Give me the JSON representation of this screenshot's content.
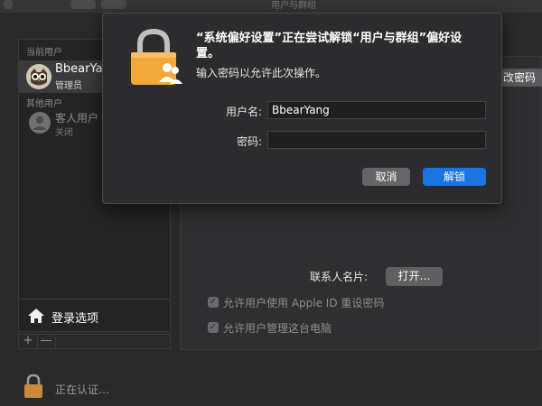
{
  "window": {
    "title_partial": "用户与群组"
  },
  "sidebar": {
    "current_users_label": "当前用户",
    "current_user": {
      "name": "BbearYang",
      "role": "管理员",
      "avatar_icon": "owl-avatar-icon"
    },
    "other_users_label": "其他用户",
    "guest": {
      "name": "客人用户",
      "status": "关闭"
    },
    "login_options": {
      "label": "登录选项",
      "icon": "house-icon"
    },
    "add_symbol": "+",
    "remove_symbol": "—"
  },
  "main": {
    "change_password_label": "改密码",
    "contact_card_label": "联系人名片:",
    "open_button_label": "打开…",
    "checkbox_apple_id": {
      "label": "允许用户使用 Apple ID 重设密码",
      "checked": true
    },
    "checkbox_admin": {
      "label": "允许用户管理这台电脑",
      "checked": true
    }
  },
  "status": {
    "authenticating": "正在认证…",
    "lock_icon": "lock-icon"
  },
  "dialog": {
    "title": "“系统偏好设置”正在尝试解锁“用户与群组”偏好设置。",
    "message": "输入密码以允许此次操作。",
    "username_label": "用户名:",
    "username_value": "BbearYang",
    "password_label": "密码:",
    "password_value": "",
    "cancel_label": "取消",
    "unlock_label": "解锁",
    "icon": "lock-users-icon"
  },
  "colors": {
    "accent": "#1a73e0",
    "lock_orange": "#f2a93b",
    "lock_status": "#d08a3a"
  }
}
